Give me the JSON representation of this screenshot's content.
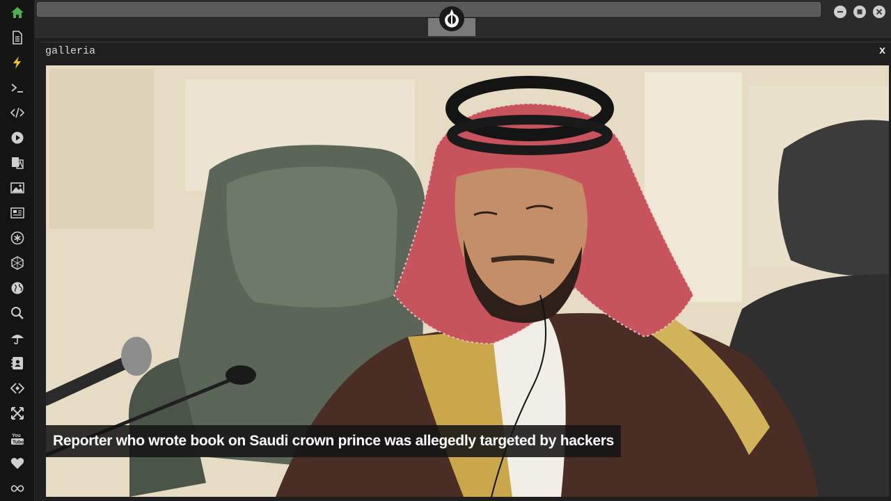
{
  "window": {
    "title": "galleria",
    "close_label": "x"
  },
  "gallery": {
    "caption": "Reporter who wrote book on Saudi crown prince was allegedly targeted by hackers"
  },
  "sidebar": {
    "items": [
      {
        "icon": "home-icon",
        "color": "#4caf50"
      },
      {
        "icon": "document-icon"
      },
      {
        "icon": "lightning-icon",
        "color": "#f5c518"
      },
      {
        "icon": "terminal-icon"
      },
      {
        "icon": "code-icon"
      },
      {
        "icon": "play-icon"
      },
      {
        "icon": "translate-icon"
      },
      {
        "icon": "image-icon"
      },
      {
        "icon": "newspaper-icon"
      },
      {
        "icon": "asterisk-icon"
      },
      {
        "icon": "hexagon-icon"
      },
      {
        "icon": "globe-icon"
      },
      {
        "icon": "search-icon"
      },
      {
        "icon": "umbrella-icon"
      },
      {
        "icon": "contact-icon"
      },
      {
        "icon": "link-icon"
      },
      {
        "icon": "expand-icon"
      },
      {
        "icon": "youtube-icon"
      },
      {
        "icon": "heart-icon"
      },
      {
        "icon": "infinity-icon"
      }
    ]
  },
  "colors": {
    "sidebar_bg": "#141414",
    "topbar_bg": "#2b2b2b",
    "accent_green": "#4caf50",
    "accent_yellow": "#f5c518"
  }
}
